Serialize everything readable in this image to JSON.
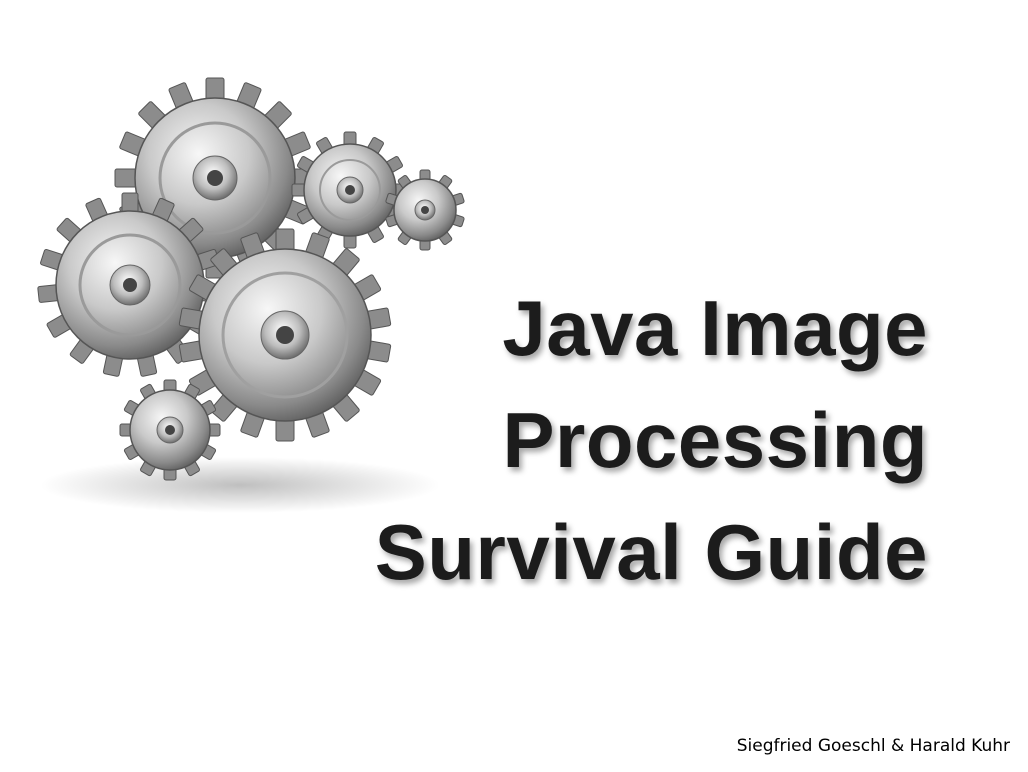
{
  "slide": {
    "title_lines": [
      "Java Image",
      "Processing",
      "Survival Guide"
    ],
    "authors": "Siegfried Goeschl & Harald Kuhr"
  },
  "image": {
    "icon": "gears-icon"
  },
  "colors": {
    "background": "#ffffff",
    "title_text": "#1c1c1c",
    "metal_light": "#e6e6e6",
    "metal_dark": "#5a5a5a"
  }
}
